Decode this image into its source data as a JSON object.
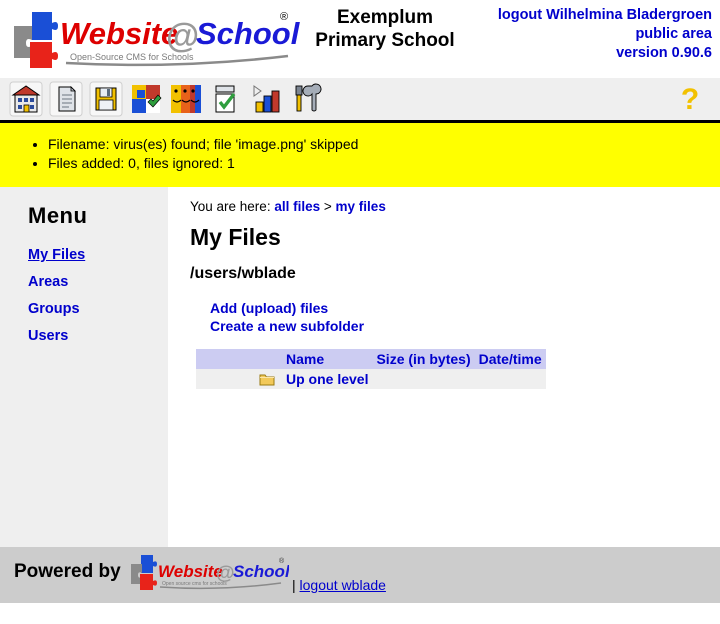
{
  "header": {
    "logo_alt": "Website@School",
    "logo_word1": "Website",
    "logo_at": "@",
    "logo_word2": "School",
    "logo_tagline": "Open-Source CMS for Schools",
    "logo_trademark": "®",
    "school_line1": "Exemplum",
    "school_line2": "Primary School",
    "logout_label": "logout Wilhelmina Bladergroen",
    "area_label": "public area",
    "version_label": "version 0.90.6"
  },
  "toolbar": {
    "icons": [
      {
        "name": "home-icon",
        "title": "Home"
      },
      {
        "name": "page-icon",
        "title": "Pages"
      },
      {
        "name": "save-icon",
        "title": "Save"
      },
      {
        "name": "modules-icon",
        "title": "Modules"
      },
      {
        "name": "users-icon",
        "title": "Users"
      },
      {
        "name": "tasks-icon",
        "title": "Tasks"
      },
      {
        "name": "statistics-icon",
        "title": "Statistics"
      },
      {
        "name": "tools-icon",
        "title": "Tools"
      }
    ],
    "help": {
      "name": "help-icon",
      "glyph": "?"
    }
  },
  "messages": [
    "Filename: virus(es) found; file 'image.png' skipped",
    "Files added: 0, files ignored: 1"
  ],
  "sidebar": {
    "title": "Menu",
    "items": [
      {
        "label": "My Files",
        "current": true
      },
      {
        "label": "Areas",
        "current": false
      },
      {
        "label": "Groups",
        "current": false
      },
      {
        "label": "Users",
        "current": false
      }
    ]
  },
  "main": {
    "breadcrumb_prefix": "You are here:",
    "breadcrumb": [
      {
        "label": "all files"
      },
      {
        "label": "my files"
      }
    ],
    "breadcrumb_separator": ">",
    "page_title": "My Files",
    "path": "/users/wblade",
    "actions": [
      {
        "label": "Add (upload) files"
      },
      {
        "label": "Create a new subfolder"
      }
    ],
    "table": {
      "headers": [
        "",
        "",
        "",
        "Name",
        "Size (in bytes)",
        "Date/time"
      ],
      "rows": [
        {
          "checkbox": "",
          "action1": "",
          "icon": "folder-icon",
          "name": "Up one level",
          "size": "",
          "datetime": ""
        }
      ]
    }
  },
  "footer": {
    "powered_by": "Powered by",
    "logo_word1": "Website",
    "logo_at": "@",
    "logo_word2": "School",
    "logo_tagline": "Open source cms for schools",
    "logo_trademark": "®",
    "separator": "|",
    "logout_label": "logout wblade"
  },
  "colors": {
    "link": "#0000cc",
    "message_bg": "#ffff00",
    "sidebar_bg": "#efefef",
    "footer_bg": "#cccccc",
    "table_header_bg": "#ccccf2",
    "table_row_bg": "#efefef",
    "logo_red": "#dd0000",
    "logo_blue": "#0000cc",
    "logo_gray": "#888888",
    "help_yellow": "#f2c100"
  }
}
